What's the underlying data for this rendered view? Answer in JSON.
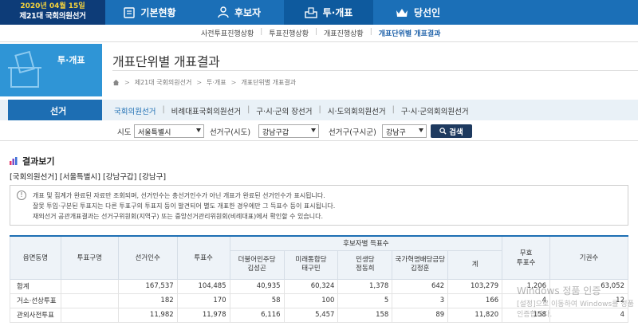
{
  "logo": {
    "line1": "2020년 04월 15일",
    "line2": "제21대 국회의원선거"
  },
  "nav": [
    {
      "label": "기본현황",
      "icon": "document-icon"
    },
    {
      "label": "후보자",
      "icon": "person-icon"
    },
    {
      "label": "투·개표",
      "icon": "ballot-box-icon"
    },
    {
      "label": "당선인",
      "icon": "crown-icon"
    }
  ],
  "subnav": [
    "사전투표진행상황",
    "투표진행상황",
    "개표진행상황",
    "개표단위별 개표결과"
  ],
  "banner": {
    "section": "투·개표",
    "page_title": "개표단위별 개표결과"
  },
  "breadcrumb": [
    "제21대 국회의원선거",
    "투·개표",
    "개표단위별 개표결과"
  ],
  "selection": {
    "label": "선거",
    "tabs": [
      "국회의원선거",
      "비례대표국회의원선거",
      "구·시·군의 장선거",
      "시·도의회의원선거",
      "구·시·군의회의원선거"
    ],
    "filters": [
      {
        "label": "시도",
        "value": "서울특별시"
      },
      {
        "label": "선거구(시도)",
        "value": "강남구갑"
      },
      {
        "label": "선거구(구시군)",
        "value": "강남구"
      }
    ],
    "search_label": "검색"
  },
  "results": {
    "title": "결과보기",
    "path": "[국회의원선거] [서울특별시] [강남구갑] [강남구]",
    "notice": [
      "개표 및 집계가 완료된 자료만 조회되며, 선거인수는 총선거인수가 아닌 개표가 완료된 선거인수가 표시됩니다.",
      "잘못 투입·구분된 투표지는 다른 투표구의 투표지 등이 발견되어 별도 개표한 경우에만 그 득표수 등이 표시됩니다.",
      "재외선거 공관개표결과는 선거구위원회(지역구) 또는 중앙선거관리위원회(비례대표)에서 확인할 수 있습니다."
    ],
    "table": {
      "headers": {
        "eup": "읍면동명",
        "booth": "투표구명",
        "electors": "선거인수",
        "voters": "투표수",
        "group": "후보자별 득표수",
        "candidates": [
          {
            "party": "더불어민주당",
            "name": "김성곤"
          },
          {
            "party": "미래통합당",
            "name": "태구민"
          },
          {
            "party": "민생당",
            "name": "정동희"
          },
          {
            "party": "국가혁명배당금당",
            "name": "김정훈"
          }
        ],
        "total": "계",
        "invalid": "무효\n투표수",
        "abstain": "기권수"
      },
      "rows": [
        {
          "eup": "합계",
          "booth": "",
          "electors": "167,537",
          "voters": "104,485",
          "c1": "40,935",
          "c2": "60,324",
          "c3": "1,378",
          "c4": "642",
          "total": "103,279",
          "invalid": "1,206",
          "abstain": "63,052"
        },
        {
          "eup": "거소·선상투표",
          "booth": "",
          "electors": "182",
          "voters": "170",
          "c1": "58",
          "c2": "100",
          "c3": "5",
          "c4": "3",
          "total": "166",
          "invalid": "4",
          "abstain": "12"
        },
        {
          "eup": "관외사전투표",
          "booth": "",
          "electors": "11,982",
          "voters": "11,978",
          "c1": "6,116",
          "c2": "5,457",
          "c3": "158",
          "c4": "89",
          "total": "11,820",
          "invalid": "158",
          "abstain": "4"
        }
      ]
    }
  },
  "overlay": {
    "line1": "Windows 정품 인증",
    "line2": "[설정]으로 이동하여 Windows를 정품 인증합니다."
  },
  "colors": {
    "nav_bg": "#1b6fb7",
    "nav_active": "#0e5a9e",
    "logo_bg": "#0d3c78",
    "accent": "#1d6eb3"
  }
}
